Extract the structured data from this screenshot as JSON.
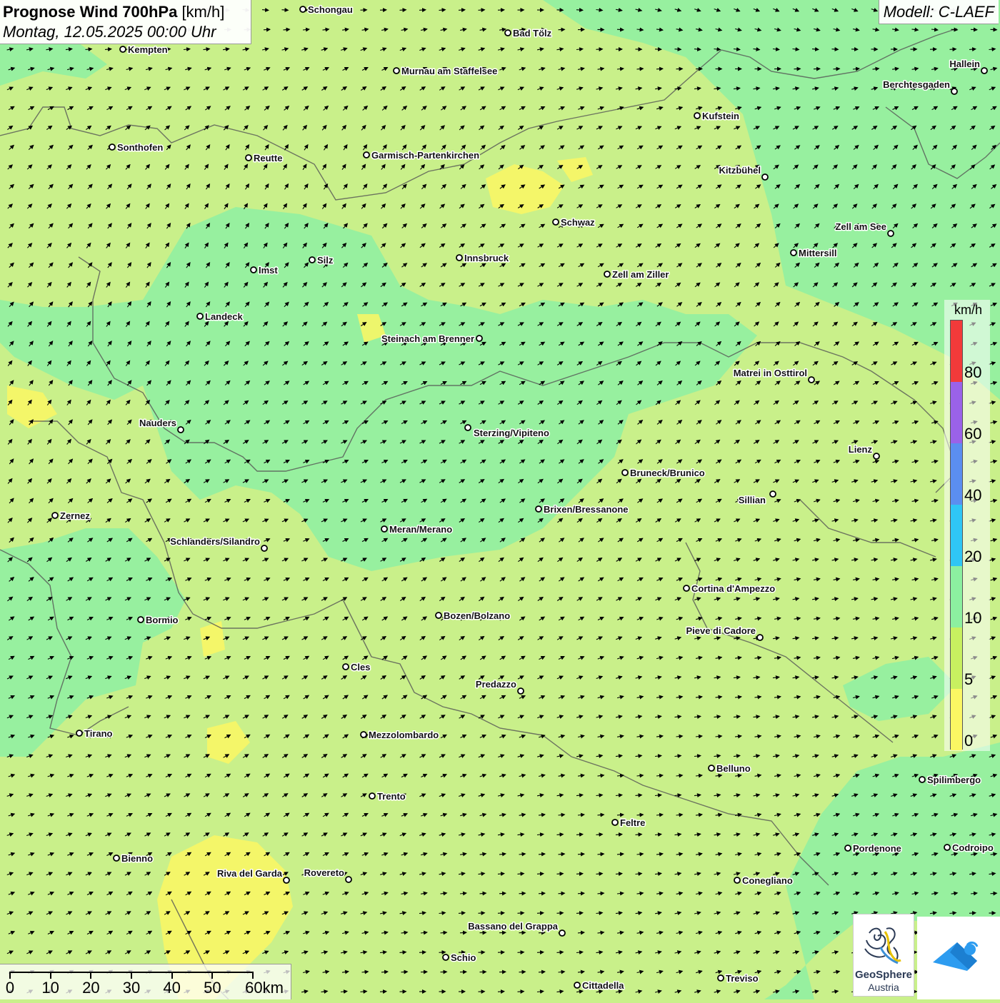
{
  "header": {
    "title_bold": "Prognose Wind 700hPa",
    "title_unit": "[km/h]",
    "date": "Montag, 12.05.2025 00:00 Uhr"
  },
  "model": {
    "label": "Modell: C-LAEF"
  },
  "legend": {
    "unit": "km/h",
    "ticks": [
      "80",
      "60",
      "40",
      "20",
      "10",
      "5",
      "0"
    ],
    "colors": [
      "#f23a3a",
      "#9a62e8",
      "#5b8ef0",
      "#2fc6f5",
      "#8cf0a0",
      "#c8f060",
      "#fbf763"
    ]
  },
  "scale": {
    "labels": [
      "0",
      "10",
      "20",
      "30",
      "40",
      "50",
      "60km"
    ]
  },
  "logo": {
    "line1": "GeoSphere",
    "line2": "Austria"
  },
  "wind_colors": {
    "calm": "#fbf763",
    "light": "#c9f08a",
    "moderate": "#8ef0a2"
  },
  "cities": [
    {
      "name": "Schongau"
    },
    {
      "name": "Bad Tölz"
    },
    {
      "name": "Kempten"
    },
    {
      "name": "Murnau am Staffelsee"
    },
    {
      "name": "Hallein"
    },
    {
      "name": "Berchtesgaden"
    },
    {
      "name": "Kufstein"
    },
    {
      "name": "Sonthofen"
    },
    {
      "name": "Reutte"
    },
    {
      "name": "Garmisch-Partenkirchen"
    },
    {
      "name": "Kitzbühel"
    },
    {
      "name": "Schwaz"
    },
    {
      "name": "Zell am See"
    },
    {
      "name": "Mittersill"
    },
    {
      "name": "Innsbruck"
    },
    {
      "name": "Silz"
    },
    {
      "name": "Imst"
    },
    {
      "name": "Zell am Ziller"
    },
    {
      "name": "Landeck"
    },
    {
      "name": "Steinach am Brenner"
    },
    {
      "name": "Matrei in Osttirol"
    },
    {
      "name": "Nauders"
    },
    {
      "name": "Sterzing/Vipiteno"
    },
    {
      "name": "Lienz"
    },
    {
      "name": "Bruneck/Brunico"
    },
    {
      "name": "Sillian"
    },
    {
      "name": "Brixen/Bressanone"
    },
    {
      "name": "Zernez"
    },
    {
      "name": "Meran/Merano"
    },
    {
      "name": "Schlanders/Silandro"
    },
    {
      "name": "Cortina d'Ampezzo"
    },
    {
      "name": "Bozen/Bolzano"
    },
    {
      "name": "Bormio"
    },
    {
      "name": "Pieve di Cadore"
    },
    {
      "name": "Cles"
    },
    {
      "name": "Predazzo"
    },
    {
      "name": "Tirano"
    },
    {
      "name": "Mezzolombardo"
    },
    {
      "name": "Belluno"
    },
    {
      "name": "Spilimbergo"
    },
    {
      "name": "Trento"
    },
    {
      "name": "Feltre"
    },
    {
      "name": "Pordenone"
    },
    {
      "name": "Codroipo"
    },
    {
      "name": "Bienno"
    },
    {
      "name": "Riva del Garda"
    },
    {
      "name": "Rovereto"
    },
    {
      "name": "Conegliano"
    },
    {
      "name": "Bassano del Grappa"
    },
    {
      "name": "Schio"
    },
    {
      "name": "Treviso"
    },
    {
      "name": "Cittadella"
    }
  ]
}
